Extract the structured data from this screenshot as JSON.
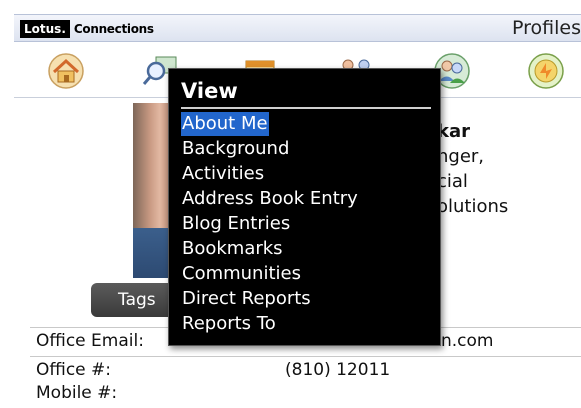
{
  "header": {
    "logo_brand": "Lotus.",
    "logo_product": "Connections",
    "app_title": "Profiles"
  },
  "toolbar": {
    "icons": [
      "home-icon",
      "search-profile-icon",
      "calendar-icon",
      "network-icon",
      "people-icon",
      "status-icon"
    ]
  },
  "profile": {
    "name_fragment": "kar",
    "title_fragment_1": "nger,",
    "title_fragment_2": "cial",
    "title_fragment_3": "olutions",
    "tags_label": "Tags"
  },
  "info": {
    "office_email_label": "Office Email:",
    "office_email_value_fragment": "n.com",
    "office_number_label": "Office #:",
    "office_number_value": "(810) 12011",
    "mobile_label": "Mobile #:"
  },
  "menu": {
    "title": "View",
    "items": [
      {
        "label": "About Me",
        "selected": true
      },
      {
        "label": "Background"
      },
      {
        "label": "Activities"
      },
      {
        "label": "Address Book Entry"
      },
      {
        "label": "Blog Entries"
      },
      {
        "label": "Bookmarks"
      },
      {
        "label": "Communities"
      },
      {
        "label": "Direct Reports"
      },
      {
        "label": "Reports To"
      }
    ]
  },
  "colors": {
    "menu_background": "#000000",
    "menu_selection": "#2266cc",
    "header_background": "#dde3f0"
  }
}
